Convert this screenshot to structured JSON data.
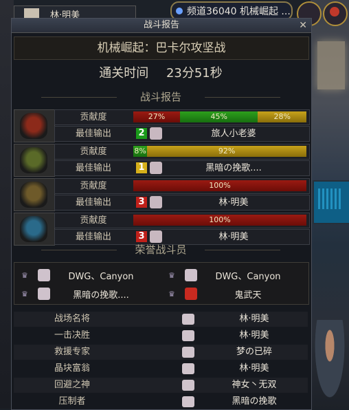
{
  "hud": {
    "player_tab": "林·明美",
    "channel_label": "频道36040 机械崛起 ..."
  },
  "report": {
    "title": "战斗报告",
    "close_glyph": "✕",
    "dungeon": "机械崛起：巴卡尔攻坚战",
    "clear_time_label": "通关时间",
    "clear_time_value": "23分51秒",
    "section_report": "战斗报告",
    "contribution_label": "贡献度",
    "best_output_label": "最佳输出",
    "section_honor": "荣誉战斗员"
  },
  "party": [
    {
      "mask_color": "#8c2a1a",
      "bars": [
        {
          "pct": "27%",
          "value": 27,
          "color": "red"
        },
        {
          "pct": "45%",
          "value": 45,
          "color": "green"
        },
        {
          "pct": "28%",
          "value": 28,
          "color": "gold"
        }
      ],
      "rank": "2",
      "rank_color": "#1a9a1a",
      "best": "旅人小老婆"
    },
    {
      "mask_color": "#5a6a28",
      "bars": [
        {
          "pct": "8%",
          "value": 8,
          "color": "green"
        },
        {
          "pct": "92%",
          "value": 92,
          "color": "gold"
        }
      ],
      "rank": "1",
      "rank_color": "#d6b01a",
      "best": "黑暗の挽歌...."
    },
    {
      "mask_color": "#6e5a2a",
      "bars": [
        {
          "pct": "100%",
          "value": 100,
          "color": "red"
        }
      ],
      "rank": "3",
      "rank_color": "#c0201a",
      "best": "林·明美"
    },
    {
      "mask_color": "#2a6a8a",
      "bars": [
        {
          "pct": "100%",
          "value": 100,
          "color": "red"
        }
      ],
      "rank": "3",
      "rank_color": "#c0201a",
      "best": "林·明美"
    }
  ],
  "honor": [
    "DWG、Canyon",
    "DWG、Canyon",
    "黑暗の挽歌....",
    "鬼武天"
  ],
  "awards": [
    {
      "title": "战场名将",
      "name": "林·明美"
    },
    {
      "title": "一击决胜",
      "name": "林·明美"
    },
    {
      "title": "救援专家",
      "name": "梦の已碎"
    },
    {
      "title": "晶块富翁",
      "name": "林·明美"
    },
    {
      "title": "回避之神",
      "name": "神女丶无双"
    },
    {
      "title": "压制者",
      "name": "黑暗の挽歌"
    }
  ]
}
